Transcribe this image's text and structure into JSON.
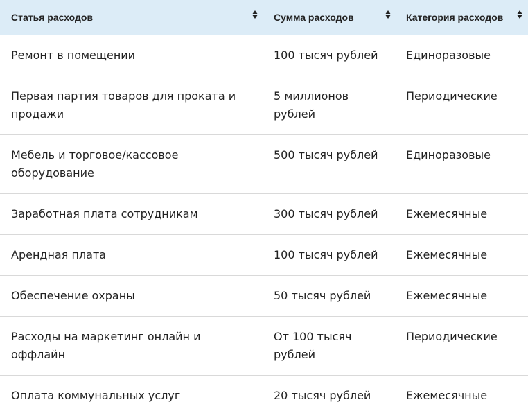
{
  "columns": [
    {
      "label": "Статья расходов"
    },
    {
      "label": "Сумма расходов"
    },
    {
      "label": "Категория расходов"
    }
  ],
  "rows": [
    {
      "item": "Ремонт в помещении",
      "amount": "100 тысяч рублей",
      "category": "Единоразовые"
    },
    {
      "item": "Первая партия товаров для проката и продажи",
      "amount": "5 миллионов рублей",
      "category": "Периодические"
    },
    {
      "item": "Мебель и торговое/кассовое оборудование",
      "amount": "500 тысяч рублей",
      "category": "Единоразовые"
    },
    {
      "item": "Заработная плата сотрудникам",
      "amount": "300 тысяч рублей",
      "category": "Ежемесячные"
    },
    {
      "item": "Арендная плата",
      "amount": "100 тысяч рублей",
      "category": "Ежемесячные"
    },
    {
      "item": "Обеспечение охраны",
      "amount": "50 тысяч рублей",
      "category": "Ежемесячные"
    },
    {
      "item": "Расходы на маркетинг онлайн и оффлайн",
      "amount": "От 100 тысяч рублей",
      "category": "Периодические"
    },
    {
      "item": "Оплата коммунальных услуг",
      "amount": "20 тысяч рублей",
      "category": "Ежемесячные"
    }
  ]
}
